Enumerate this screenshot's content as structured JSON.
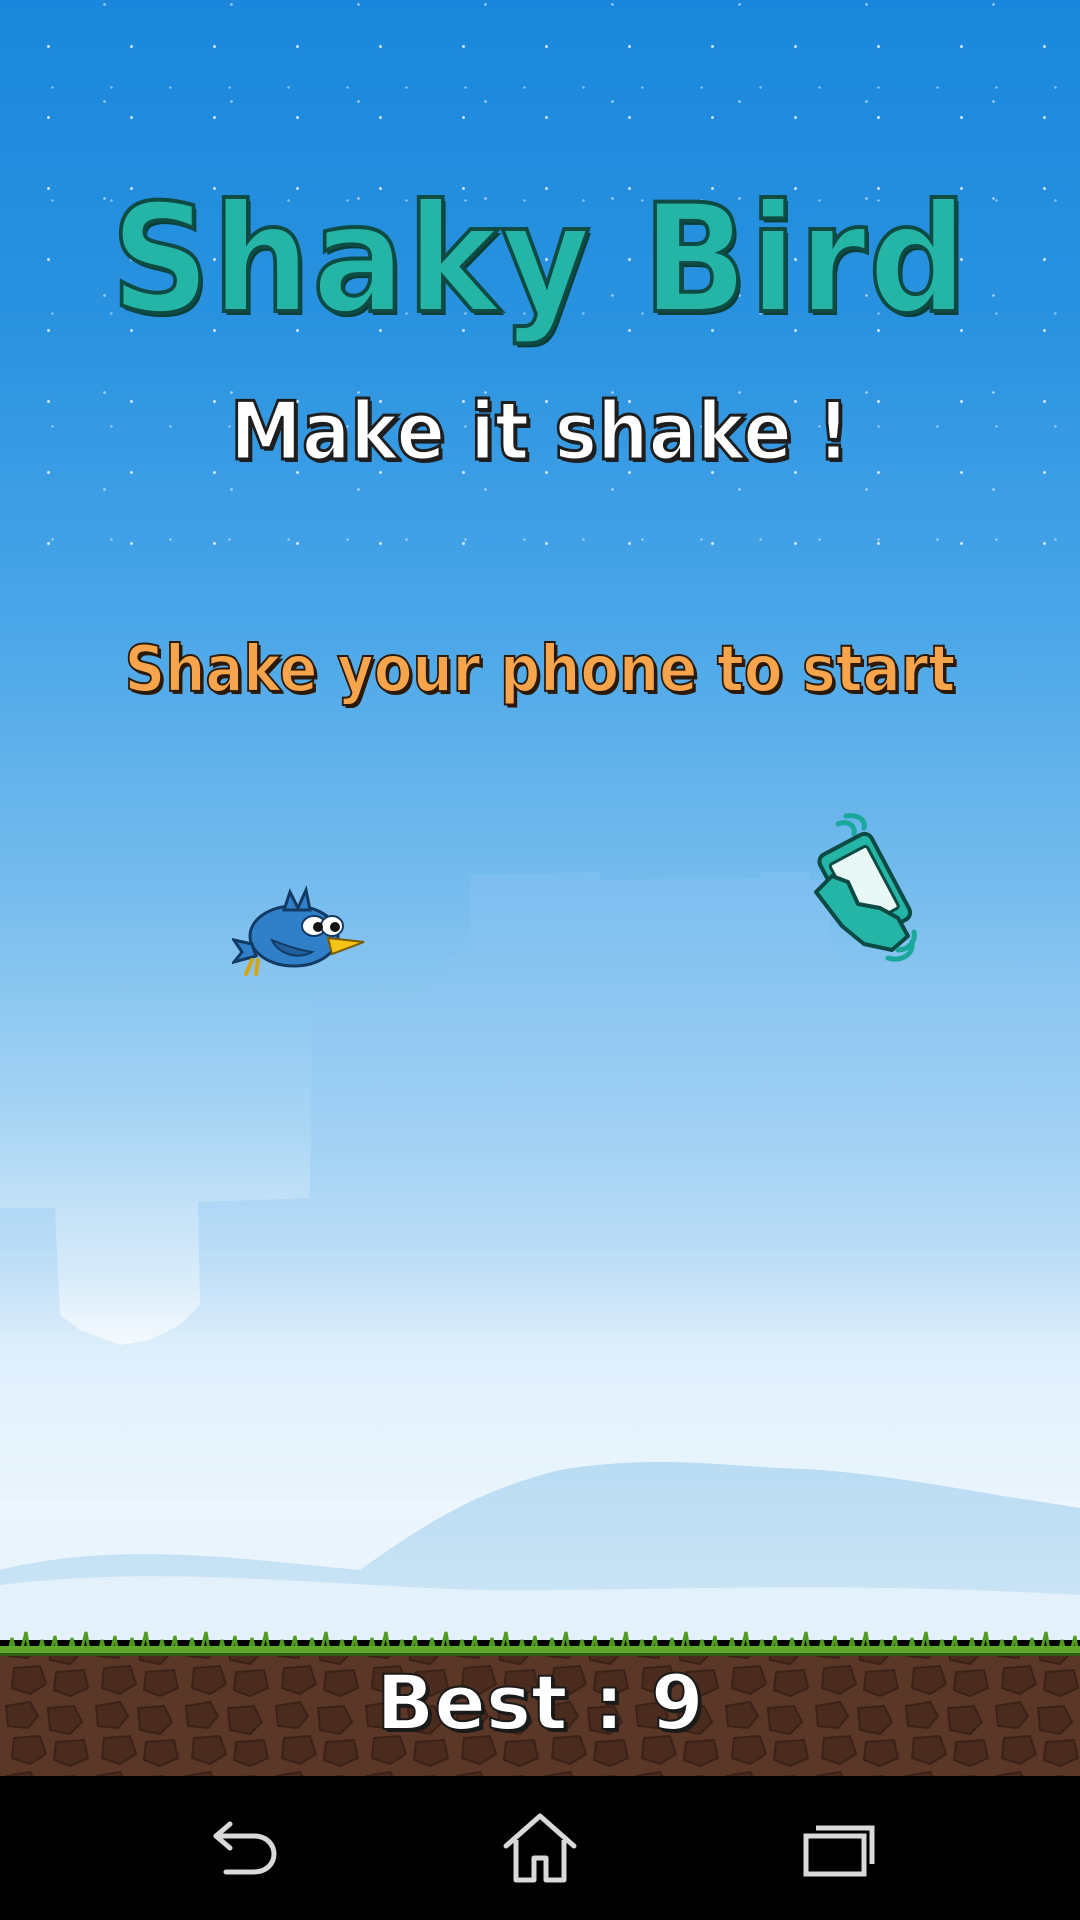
{
  "game": {
    "title": "Shaky Bird",
    "subtitle": "Make it shake !",
    "prompt": "Shake your phone to start",
    "best_label": "Best :",
    "best_score": "9"
  },
  "icons": {
    "bird": "blue-bird-icon",
    "shake": "phone-shake-icon"
  },
  "navbar": {
    "back": "back-icon",
    "home": "home-icon",
    "recents": "recents-icon"
  },
  "colors": {
    "sky_top": "#1a87dc",
    "title": "#25b5a6",
    "prompt": "#f7a54d",
    "grass": "#4f9a1f",
    "dirt": "#5a3726",
    "navbar": "#000000"
  }
}
